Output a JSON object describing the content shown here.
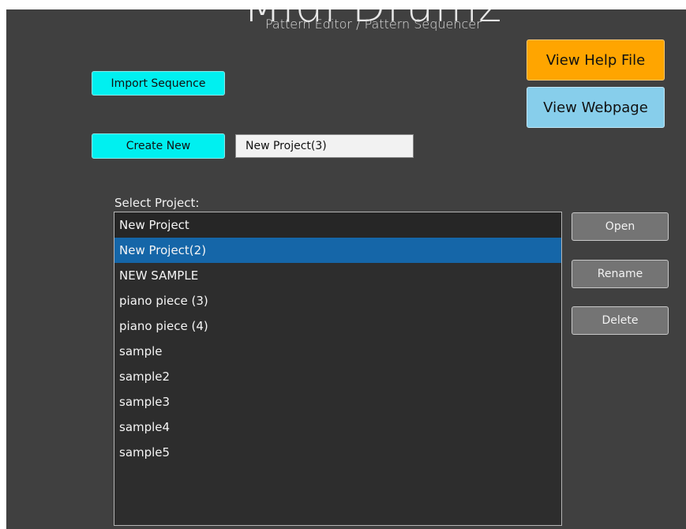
{
  "header": {
    "logo_text": "Midi Drumz",
    "subtitle": "Pattern Editor / Pattern Sequencer"
  },
  "actions": {
    "import_label": "Import Sequence",
    "create_label": "Create New",
    "new_name_value": "New Project(3)",
    "help_label": "View Help File",
    "web_label": "View Webpage"
  },
  "projects": {
    "label": "Select Project:",
    "items": [
      "New Project",
      "New Project(2)",
      "NEW SAMPLE",
      "piano piece (3)",
      "piano piece (4)",
      "sample",
      "sample2",
      "sample3",
      "sample4",
      "sample5"
    ],
    "selected": "New Project(2)"
  },
  "list_actions": {
    "open_label": "Open",
    "rename_label": "Rename",
    "delete_label": "Delete"
  },
  "colors": {
    "background": "#404040",
    "cyan_button": "#00f0f0",
    "help_button": "#ffa500",
    "web_button": "#87ceeb",
    "selection": "#1566a8"
  }
}
